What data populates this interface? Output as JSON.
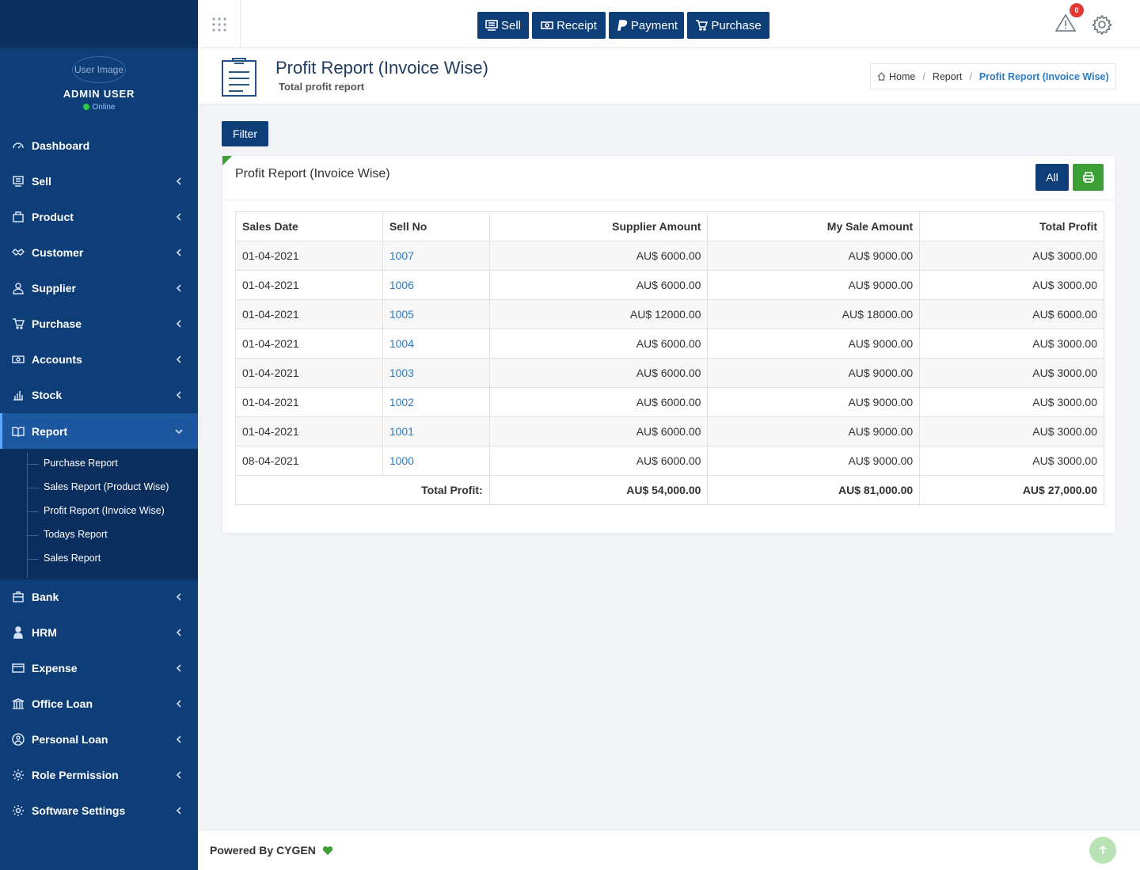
{
  "sidebar": {
    "avatar_alt": "User Image",
    "user_name": "ADMIN USER",
    "user_status": "Online",
    "items": [
      {
        "label": "Dashboard",
        "icon": "dashboard-icon"
      },
      {
        "label": "Sell",
        "icon": "sell-icon"
      },
      {
        "label": "Product",
        "icon": "product-icon"
      },
      {
        "label": "Customer",
        "icon": "handshake-icon"
      },
      {
        "label": "Supplier",
        "icon": "user-icon"
      },
      {
        "label": "Purchase",
        "icon": "cart-icon"
      },
      {
        "label": "Accounts",
        "icon": "money-icon"
      },
      {
        "label": "Stock",
        "icon": "bar-chart-icon"
      },
      {
        "label": "Report",
        "icon": "book-icon"
      },
      {
        "label": "Bank",
        "icon": "bank-box-icon"
      },
      {
        "label": "HRM",
        "icon": "person-icon"
      },
      {
        "label": "Expense",
        "icon": "credit-card-icon"
      },
      {
        "label": "Office Loan",
        "icon": "institution-icon"
      },
      {
        "label": "Personal Loan",
        "icon": "user-circle-icon"
      },
      {
        "label": "Role Permission",
        "icon": "gear-icon"
      },
      {
        "label": "Software Settings",
        "icon": "gear-icon"
      }
    ],
    "report_submenu": [
      "Purchase Report",
      "Sales Report (Product Wise)",
      "Profit Report (Invoice Wise)",
      "Todays Report",
      "Sales Report"
    ]
  },
  "topbar": {
    "buttons": [
      "Sell",
      "Receipt",
      "Payment",
      "Purchase"
    ],
    "notification_count": "0"
  },
  "header": {
    "title": "Profit Report (Invoice Wise)",
    "subtitle": "Total profit report",
    "breadcrumb": [
      "Home",
      "Report",
      "Profit Report (Invoice Wise)"
    ]
  },
  "content": {
    "filter_label": "Filter",
    "card_title": "Profit Report (Invoice Wise)",
    "all_label": "All",
    "columns": [
      "Sales Date",
      "Sell No",
      "Supplier Amount",
      "My Sale Amount",
      "Total Profit"
    ],
    "rows": [
      [
        "01-04-2021",
        "1007",
        "AU$ 6000.00",
        "AU$ 9000.00",
        "AU$ 3000.00"
      ],
      [
        "01-04-2021",
        "1006",
        "AU$ 6000.00",
        "AU$ 9000.00",
        "AU$ 3000.00"
      ],
      [
        "01-04-2021",
        "1005",
        "AU$ 12000.00",
        "AU$ 18000.00",
        "AU$ 6000.00"
      ],
      [
        "01-04-2021",
        "1004",
        "AU$ 6000.00",
        "AU$ 9000.00",
        "AU$ 3000.00"
      ],
      [
        "01-04-2021",
        "1003",
        "AU$ 6000.00",
        "AU$ 9000.00",
        "AU$ 3000.00"
      ],
      [
        "01-04-2021",
        "1002",
        "AU$ 6000.00",
        "AU$ 9000.00",
        "AU$ 3000.00"
      ],
      [
        "01-04-2021",
        "1001",
        "AU$ 6000.00",
        "AU$ 9000.00",
        "AU$ 3000.00"
      ],
      [
        "08-04-2021",
        "1000",
        "AU$ 6000.00",
        "AU$ 9000.00",
        "AU$ 3000.00"
      ]
    ],
    "totals": {
      "label": "Total Profit:",
      "supplier": "AU$ 54,000.00",
      "sale": "AU$ 81,000.00",
      "profit": "AU$ 27,000.00"
    }
  },
  "footer": {
    "text": "Powered By CYGEN"
  },
  "colors": {
    "primary": "#0e3e78",
    "accent_green": "#3aa035",
    "link": "#2d7bc4",
    "badge": "#e2382f"
  }
}
